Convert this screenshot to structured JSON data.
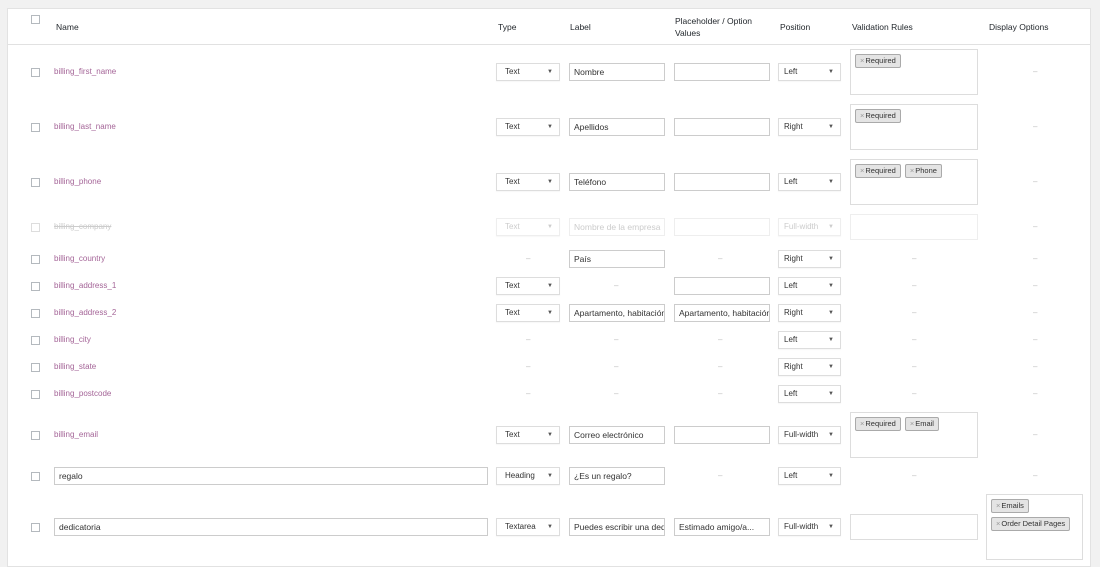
{
  "headers": {
    "name": "Name",
    "type": "Type",
    "label": "Label",
    "placeholder": "Placeholder / Option Values",
    "position": "Position",
    "validation": "Validation Rules",
    "display": "Display Options"
  },
  "dash": "–",
  "tag_remove": "×",
  "rows": [
    {
      "name": "billing_first_name",
      "type": "Text",
      "label": "Nombre",
      "placeholder": "",
      "position": "Left",
      "validation": [
        "Required"
      ],
      "display": []
    },
    {
      "name": "billing_last_name",
      "type": "Text",
      "label": "Apellidos",
      "placeholder": "",
      "position": "Right",
      "validation": [
        "Required"
      ],
      "display": []
    },
    {
      "name": "billing_phone",
      "type": "Text",
      "label": "Teléfono",
      "placeholder": "",
      "position": "Left",
      "validation": [
        "Required",
        "Phone"
      ],
      "display": []
    },
    {
      "name": "billing_company",
      "type": "Text",
      "label": "Nombre de la empresa",
      "placeholder": "",
      "position": "Full-width",
      "validation": [],
      "display": []
    },
    {
      "name": "billing_country",
      "type": "",
      "label": "País",
      "placeholder": "",
      "position": "Right",
      "validation": [],
      "display": []
    },
    {
      "name": "billing_address_1",
      "type": "Text",
      "label": "",
      "placeholder": "",
      "position": "Left",
      "validation": [],
      "display": []
    },
    {
      "name": "billing_address_2",
      "type": "Text",
      "label": "Apartamento, habitación, etc.",
      "placeholder": "Apartamento, habitación, etc.",
      "position": "Right",
      "validation": [],
      "display": []
    },
    {
      "name": "billing_city",
      "type": "",
      "label": "",
      "placeholder": "",
      "position": "Left",
      "validation": [],
      "display": []
    },
    {
      "name": "billing_state",
      "type": "",
      "label": "",
      "placeholder": "",
      "position": "Right",
      "validation": [],
      "display": []
    },
    {
      "name": "billing_postcode",
      "type": "",
      "label": "",
      "placeholder": "",
      "position": "Left",
      "validation": [],
      "display": []
    },
    {
      "name": "billing_email",
      "type": "Text",
      "label": "Correo electrónico",
      "placeholder": "",
      "position": "Full-width",
      "validation": [
        "Required",
        "Email"
      ],
      "display": []
    },
    {
      "name": "regalo",
      "type": "Heading",
      "label": "¿Es un regalo?",
      "placeholder": "",
      "position": "Left",
      "validation": [],
      "display": []
    },
    {
      "name": "dedicatoria",
      "type": "Textarea",
      "label": "Puedes escribir una dedicatoria",
      "placeholder": "Estimado amigo/a...",
      "position": "Full-width",
      "validation": [],
      "display": [
        "Emails",
        "Order Detail Pages"
      ]
    }
  ]
}
